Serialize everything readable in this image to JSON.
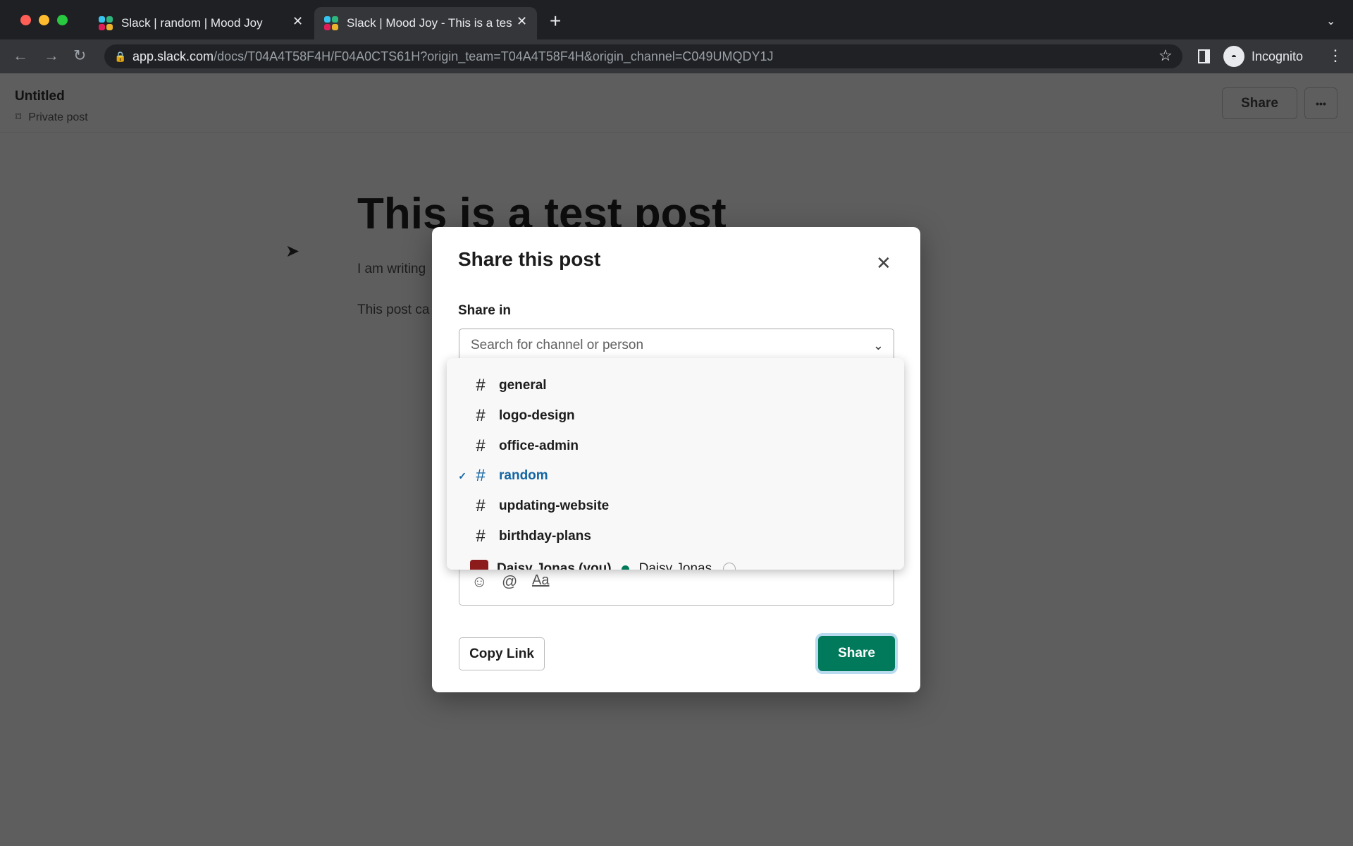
{
  "browser": {
    "tabs": [
      {
        "title": "Slack | random | Mood Joy",
        "active": false
      },
      {
        "title": "Slack | Mood Joy - This is a tes",
        "active": true
      }
    ],
    "new_tab": "+",
    "url_host": "app.slack.com",
    "url_path": "/docs/T04A4T58F4H/F04A0CTS61H?origin_team=T04A4T58F4H&origin_channel=C049UMQDY1J",
    "profile": "Incognito"
  },
  "header": {
    "title": "Untitled",
    "subtitle": "Private post",
    "share": "Share",
    "more": "•••"
  },
  "document": {
    "title": "This is a test post",
    "paragraphs": [
      "I am writing",
      "This post ca"
    ]
  },
  "modal": {
    "title": "Share this post",
    "share_in_label": "Share in",
    "search_placeholder": "Search for channel or person",
    "options": [
      {
        "label": "general",
        "selected": false
      },
      {
        "label": "logo-design",
        "selected": false
      },
      {
        "label": "office-admin",
        "selected": false
      },
      {
        "label": "random",
        "selected": true
      },
      {
        "label": "updating-website",
        "selected": false
      },
      {
        "label": "birthday-plans",
        "selected": false
      }
    ],
    "person": {
      "display": "Daisy Jonas (you)",
      "name": "Daisy Jonas",
      "status": "online"
    },
    "toolbar": {
      "format": "Aa"
    },
    "copy_link": "Copy Link",
    "share": "Share"
  },
  "colors": {
    "accent": "#007a5a",
    "selected": "#1264a3",
    "overlay": "#5e5e5e"
  }
}
